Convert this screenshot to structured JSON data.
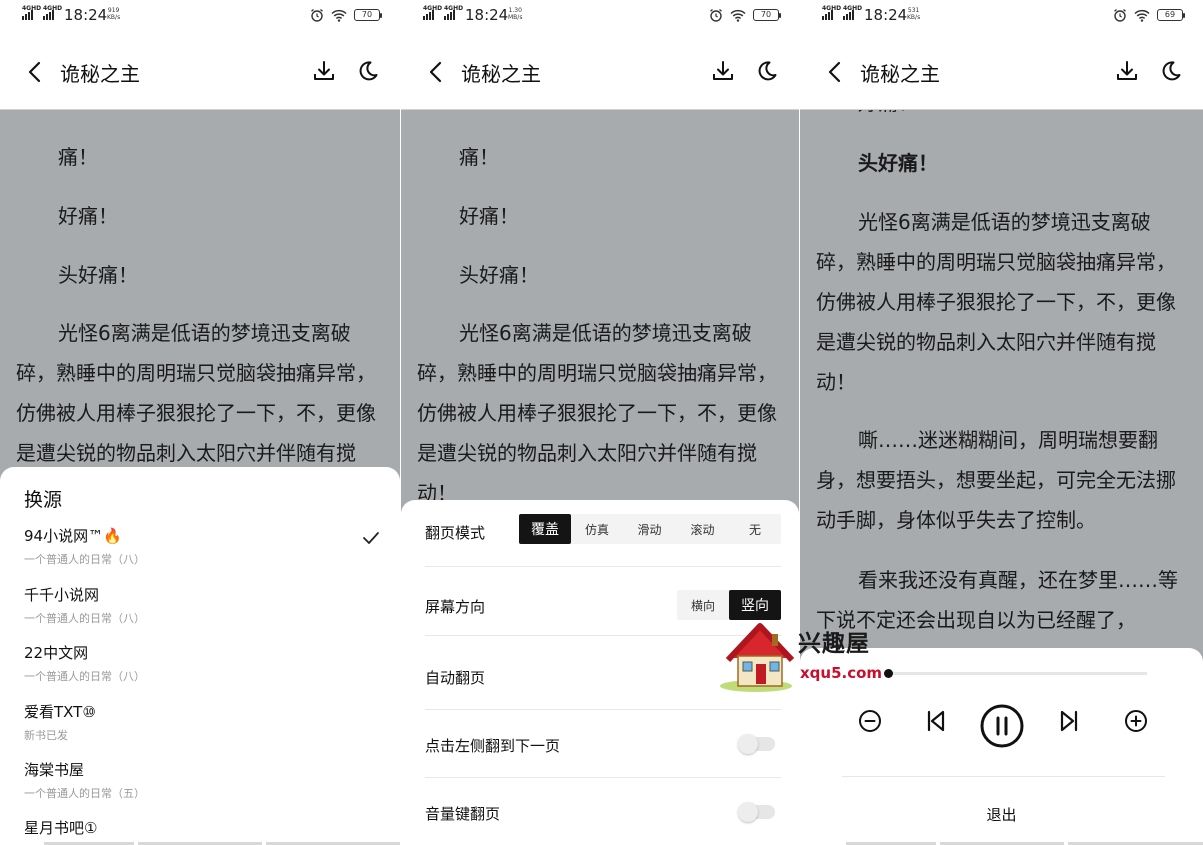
{
  "status": [
    {
      "time": "18:24",
      "speed_top": "919",
      "speed_unit": "KB/s",
      "battery": "70"
    },
    {
      "time": "18:24",
      "speed_top": "1.30",
      "speed_unit": "MB/s",
      "battery": "70"
    },
    {
      "time": "18:24",
      "speed_top": "531",
      "speed_unit": "KB/s",
      "battery": "69"
    }
  ],
  "network_label": "4GHD",
  "book_title": "诡秘之主",
  "reader_text": {
    "p1": "痛！",
    "p2": "好痛！",
    "p3": "头好痛！",
    "p4": "光怪6离满是低语的梦境迅支离破碎，熟睡中的周明瑞只觉脑袋抽痛异常，仿佛被人用棒子狠狠抡了一下，不，更像是遭尖锐的物品刺入太阳穴并伴随有搅动！",
    "p5": "嘶……迷迷糊糊间，周明瑞想要翻身，想要捂头，想要坐起，可完全无法挪动手脚，身体似乎失去了控制。",
    "p6": "看来我还没有真醒，还在梦里……等下说不定还会出现自以为已经醒了，",
    "p0_partial": "好痛！"
  },
  "source_sheet": {
    "title": "换源",
    "items": [
      {
        "name": "94小说网™🔥",
        "sub": "一个普通人的日常（八）",
        "selected": true
      },
      {
        "name": "千千小说网",
        "sub": "一个普通人的日常（八）",
        "selected": false
      },
      {
        "name": "22中文网",
        "sub": "一个普通人的日常（八）",
        "selected": false
      },
      {
        "name": "爱看TXT⑩",
        "sub": "新书已发",
        "selected": false
      },
      {
        "name": "海棠书屋",
        "sub": "一个普通人的日常（五）",
        "selected": false
      },
      {
        "name": "星月书吧①",
        "sub": "",
        "selected": false
      }
    ]
  },
  "settings": {
    "page_mode_label": "翻页模式",
    "page_modes": [
      "覆盖",
      "仿真",
      "滑动",
      "滚动",
      "无"
    ],
    "page_mode_selected": "覆盖",
    "orientation_label": "屏幕方向",
    "orientations": [
      "横向",
      "竖向"
    ],
    "orientation_selected": "竖向",
    "auto_page_label": "自动翻页",
    "tap_left_label": "点击左侧翻到下一页",
    "tap_left_on": false,
    "volume_key_label": "音量键翻页",
    "volume_key_on": false
  },
  "tts": {
    "progress": 0.0,
    "exit_label": "退出"
  },
  "watermark": {
    "name": "兴趣屋",
    "url": "xqu5.com"
  }
}
